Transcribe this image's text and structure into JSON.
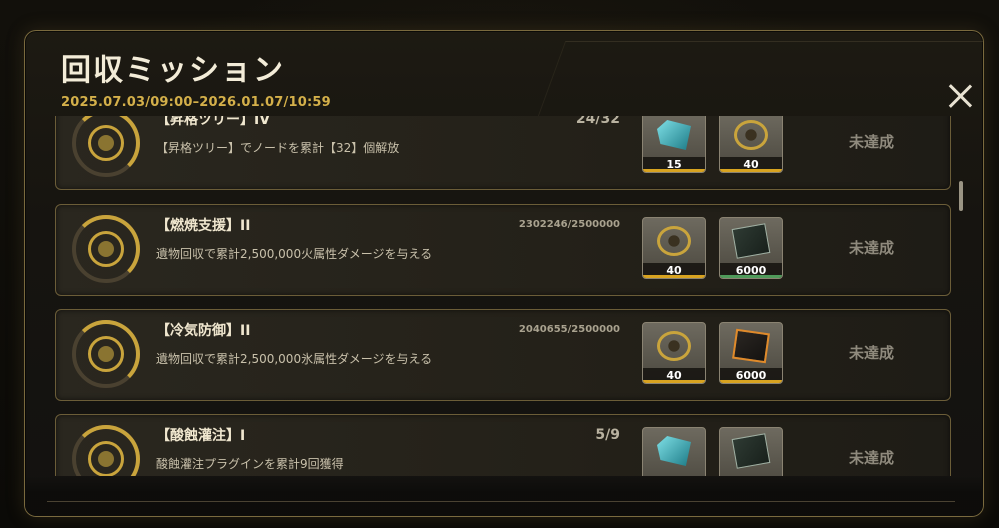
{
  "header": {
    "title": "回収ミッション",
    "period": "2025.07.03/09:00–2026.01.07/10:59"
  },
  "missions": [
    {
      "name": "【昇格ツリー】IV",
      "desc": "【昇格ツリー】でノードを累計【32】個解放",
      "progress": "24/32",
      "status": "未達成",
      "rewards": [
        {
          "icon": "crystal-icon",
          "count": "15",
          "rarity": "gold"
        },
        {
          "icon": "gear-token-icon",
          "count": "40",
          "rarity": "gold"
        }
      ]
    },
    {
      "name": "【燃焼支援】II",
      "desc": "遺物回収で累計2,500,000火属性ダメージを与える",
      "progress": "2302246/2500000",
      "status": "未達成",
      "rewards": [
        {
          "icon": "gear-token-icon",
          "count": "40",
          "rarity": "gold"
        },
        {
          "icon": "card-chip-icon",
          "count": "6000",
          "rarity": "green"
        }
      ]
    },
    {
      "name": "【冷気防御】II",
      "desc": "遺物回収で累計2,500,000氷属性ダメージを与える",
      "progress": "2040655/2500000",
      "status": "未達成",
      "rewards": [
        {
          "icon": "gear-token-icon",
          "count": "40",
          "rarity": "gold"
        },
        {
          "icon": "card-chip-orange-icon",
          "count": "6000",
          "rarity": "gold"
        }
      ]
    },
    {
      "name": "【酸蝕灌注】I",
      "desc": "酸蝕灌注プラグインを累計9回獲得",
      "progress": "5/9",
      "status": "未達成",
      "rewards": [
        {
          "icon": "crystal-icon",
          "count": "",
          "rarity": "gold"
        },
        {
          "icon": "card-chip-icon",
          "count": "",
          "rarity": "green"
        }
      ]
    }
  ]
}
